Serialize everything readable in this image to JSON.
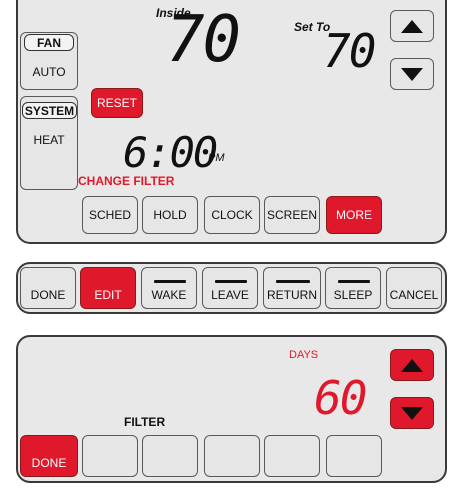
{
  "screen1": {
    "inside_label": "Inside",
    "inside_temp": "70",
    "setto_label": "Set To",
    "setto_temp": "70",
    "fan_label": "FAN",
    "fan_value": "AUTO",
    "system_label": "SYSTEM",
    "system_value": "HEAT",
    "reset_label": "RESET",
    "time": "6:00",
    "ampm": "PM",
    "change_filter": "CHANGE FILTER",
    "buttons": [
      "SCHED",
      "HOLD",
      "CLOCK",
      "SCREEN",
      "MORE"
    ]
  },
  "screen2": {
    "buttons": [
      "DONE",
      "EDIT",
      "WAKE",
      "LEAVE",
      "RETURN",
      "SLEEP",
      "CANCEL"
    ]
  },
  "screen3": {
    "days_label": "DAYS",
    "days_value": "60",
    "filter_label": "FILTER",
    "done_label": "DONE"
  },
  "colors": {
    "accent_red": "#e0182b",
    "panel_bg": "#e8e8e8"
  }
}
